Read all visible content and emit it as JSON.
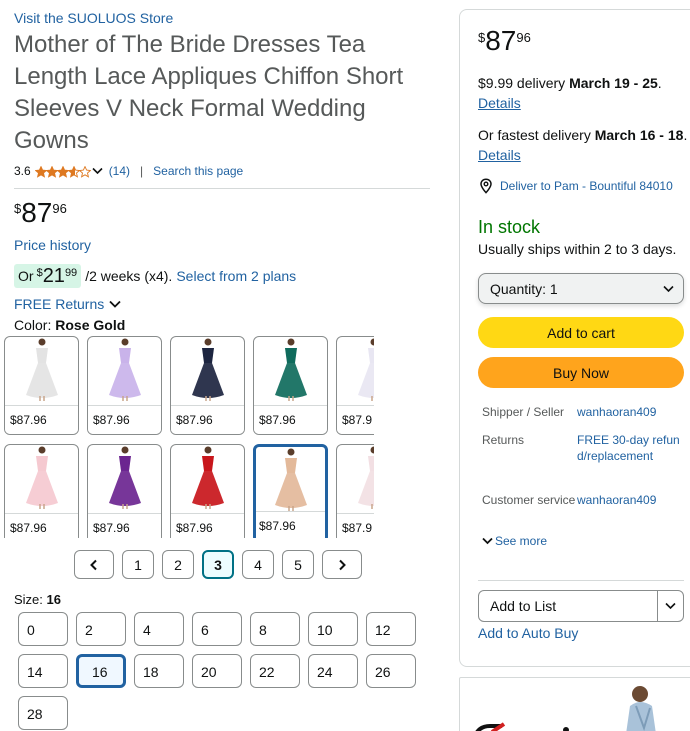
{
  "product": {
    "store_link": "Visit the SUOLUOS Store",
    "title": "Mother of The Bride Dresses Tea Length Lace Appliques Chiffon Short Sleeves V Neck Formal Wedding Gowns",
    "rating": "3.6",
    "rating_value": 3.6,
    "rating_count": "(14)",
    "search_page": "Search this page",
    "search_sep": "|",
    "price": {
      "symbol": "$",
      "whole": "87",
      "fraction": "96"
    },
    "price_history": "Price history",
    "plan": {
      "or": "Or",
      "symbol": "$",
      "whole": "21",
      "fraction": "99",
      "rest": "/2 weeks (x4).",
      "select_plans": "Select from 2 plans"
    },
    "free_returns": "FREE Returns",
    "color_label": "Color:",
    "color_value": "Rose Gold",
    "swatches": [
      {
        "price": "$87.96",
        "color": "#e3e3e3"
      },
      {
        "price": "$87.96",
        "color": "#c9b3ea"
      },
      {
        "price": "$87.96",
        "color": "#1d2540"
      },
      {
        "price": "$87.96",
        "color": "#0f6b5c"
      },
      {
        "price": "$87.9",
        "color": "#e8e6f2"
      },
      {
        "price": "$87.96",
        "color": "#f5c9d0"
      },
      {
        "price": "$87.96",
        "color": "#6b2590"
      },
      {
        "price": "$87.96",
        "color": "#c8161b"
      },
      {
        "price": "$87.96",
        "color": "#e3b99a"
      },
      {
        "price": "$87.9",
        "color": "#f2dfe3"
      }
    ],
    "selected_swatch": 8,
    "pager": {
      "prev": "‹",
      "next": "›",
      "pages": [
        "1",
        "2",
        "3",
        "4",
        "5"
      ],
      "active_index": 2
    },
    "size_label": "Size:",
    "size_value": "16",
    "sizes": [
      "0",
      "2",
      "4",
      "6",
      "8",
      "10",
      "12",
      "14",
      "16",
      "18",
      "20",
      "22",
      "24",
      "26",
      "28"
    ],
    "active_size_index": 8
  },
  "buybox": {
    "price": {
      "symbol": "$",
      "whole": "87",
      "fraction": "96"
    },
    "delivery_fee": "$9.99 delivery",
    "delivery_date": "March 19 - 25",
    "delivery_period": ".",
    "details": "Details",
    "fastest_prefix": "Or fastest delivery",
    "fastest_date": "March 16 - 18",
    "fastest_period": ".",
    "fastest_details": "Details",
    "deliver_to": "Deliver to Pam - Bountiful 84010",
    "stock": "In stock",
    "ships": "Usually ships within 2 to 3 days.",
    "quantity_label": "Quantity:",
    "quantity_value": "1",
    "add_to_cart": "Add to cart",
    "buy_now": "Buy Now",
    "info": {
      "shipper_key": "Shipper / Seller",
      "shipper_val": "wanhaoran409",
      "returns_key": "Returns",
      "returns_val": "FREE 30-day refund/replacement",
      "service_key": "Customer service",
      "service_val": "wanhaoran409",
      "see_more": "See more"
    },
    "add_to_list": "Add to List",
    "auto_buy": "Add to Auto Buy"
  },
  "colors": {
    "link": "#2162a1",
    "star": "#de7921",
    "stock_green": "#007600",
    "cart_yellow": "#ffd814",
    "buy_orange": "#ffa41c",
    "plan_badge": "#d6f5e6"
  }
}
